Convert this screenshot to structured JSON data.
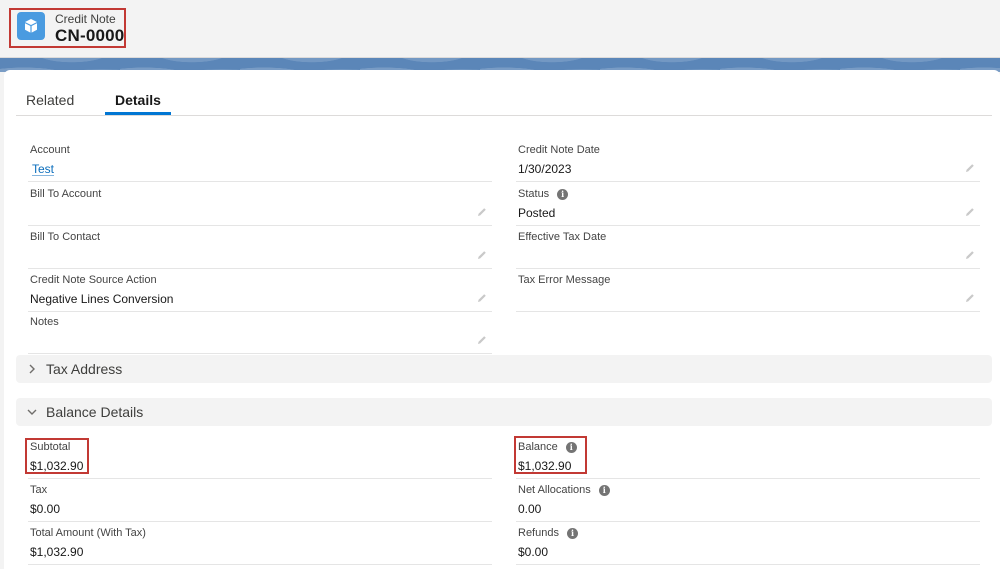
{
  "header": {
    "object_type": "Credit Note",
    "record_title": "CN-0000",
    "icon": "cube-icon"
  },
  "tabs": [
    {
      "label": "Related",
      "active": false
    },
    {
      "label": "Details",
      "active": true
    }
  ],
  "fields": {
    "account": {
      "label": "Account",
      "value": "Test"
    },
    "bill_to_account": {
      "label": "Bill To Account",
      "value": ""
    },
    "bill_to_contact": {
      "label": "Bill To Contact",
      "value": ""
    },
    "source_action": {
      "label": "Credit Note Source Action",
      "value": "Negative Lines Conversion"
    },
    "notes": {
      "label": "Notes",
      "value": ""
    },
    "credit_note_date": {
      "label": "Credit Note Date",
      "value": "1/30/2023"
    },
    "status": {
      "label": "Status",
      "value": "Posted"
    },
    "effective_tax_date": {
      "label": "Effective Tax Date",
      "value": ""
    },
    "tax_error_message": {
      "label": "Tax Error Message",
      "value": ""
    }
  },
  "sections": {
    "tax_address": {
      "title": "Tax Address",
      "expanded": false
    },
    "balance_details": {
      "title": "Balance Details",
      "expanded": true
    }
  },
  "balance": {
    "subtotal": {
      "label": "Subtotal",
      "value": "$1,032.90"
    },
    "tax": {
      "label": "Tax",
      "value": "$0.00"
    },
    "total_amount": {
      "label": "Total Amount (With Tax)",
      "value": "$1,032.90"
    },
    "balance": {
      "label": "Balance",
      "value": "$1,032.90"
    },
    "net_allocations": {
      "label": "Net Allocations",
      "value": "0.00"
    },
    "refunds": {
      "label": "Refunds",
      "value": "$0.00"
    }
  },
  "colors": {
    "accent": "#0176d3",
    "highlight": "#c23934",
    "object_icon": "#4a9be0"
  }
}
